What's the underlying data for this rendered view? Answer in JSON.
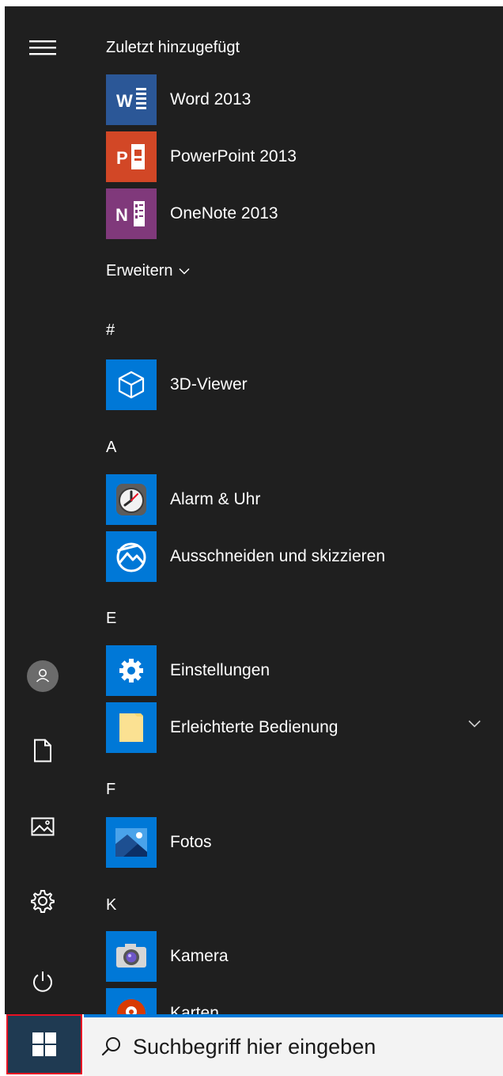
{
  "recent": {
    "title": "Zuletzt hinzugefügt",
    "apps": [
      {
        "label": "Word 2013",
        "icon": "word-icon",
        "color": "#2b5797"
      },
      {
        "label": "PowerPoint 2013",
        "icon": "powerpoint-icon",
        "color": "#d24726"
      },
      {
        "label": "OneNote 2013",
        "icon": "onenote-icon",
        "color": "#80397b"
      }
    ],
    "expand_label": "Erweitern"
  },
  "groups": {
    "hash": {
      "title": "#",
      "apps": [
        {
          "label": "3D-Viewer",
          "icon": "cube-icon"
        }
      ]
    },
    "a": {
      "title": "A",
      "apps": [
        {
          "label": "Alarm & Uhr",
          "icon": "alarm-clock-icon"
        },
        {
          "label": "Ausschneiden und skizzieren",
          "icon": "snip-sketch-icon"
        }
      ]
    },
    "e": {
      "title": "E",
      "apps": [
        {
          "label": "Einstellungen",
          "icon": "gear-icon"
        },
        {
          "label": "Erleichterte Bedienung",
          "icon": "folder-icon"
        }
      ]
    },
    "f": {
      "title": "F",
      "apps": [
        {
          "label": "Fotos",
          "icon": "photos-icon"
        }
      ]
    },
    "k": {
      "title": "K",
      "apps": [
        {
          "label": "Kamera",
          "icon": "camera-icon"
        },
        {
          "label": "Karten",
          "icon": "maps-icon"
        }
      ]
    }
  },
  "search": {
    "placeholder": "Suchbegriff hier eingeben"
  },
  "colors": {
    "menu_bg": "#1f1f1f",
    "tile_blue": "#0078d7",
    "start_highlight": "#e81123",
    "search_border": "#0078d7"
  }
}
